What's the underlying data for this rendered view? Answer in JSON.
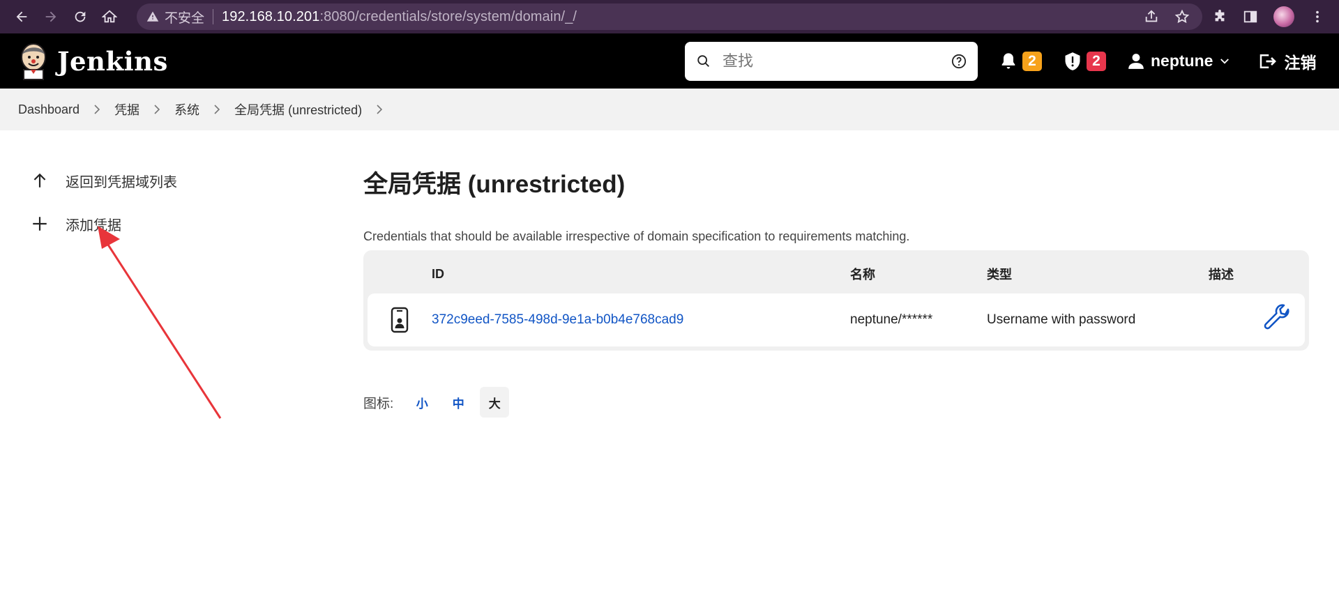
{
  "browser": {
    "security_label": "不安全",
    "url_host": "192.168.10.201",
    "url_rest": ":8080/credentials/store/system/domain/_/"
  },
  "header": {
    "brand": "Jenkins",
    "search_placeholder": "查找",
    "notifications_count": "2",
    "security_count": "2",
    "username": "neptune",
    "logout_label": "注销"
  },
  "breadcrumb": [
    "Dashboard",
    "凭据",
    "系统",
    "全局凭据 (unrestricted)"
  ],
  "sidebar": {
    "items": [
      {
        "label": "返回到凭据域列表",
        "icon": "arrow-up-icon"
      },
      {
        "label": "添加凭据",
        "icon": "plus-icon"
      }
    ]
  },
  "main": {
    "title": "全局凭据 (unrestricted)",
    "description": "Credentials that should be available irrespective of domain specification to requirements matching.",
    "table": {
      "headers": {
        "id": "ID",
        "name": "名称",
        "type": "类型",
        "desc": "描述"
      },
      "rows": [
        {
          "id": "372c9eed-7585-498d-9e1a-b0b4e768cad9",
          "name": "neptune/******",
          "type": "Username with password",
          "desc": ""
        }
      ]
    },
    "icon_size": {
      "label": "图标:",
      "options": [
        "小",
        "中",
        "大"
      ],
      "selected": "大"
    }
  },
  "colors": {
    "browser_bg": "#35213e",
    "header_bg": "#000000",
    "link": "#1155c5",
    "badge_orange": "#f7a21b",
    "badge_red": "#e7364c",
    "annotation_arrow": "#e8353a"
  }
}
